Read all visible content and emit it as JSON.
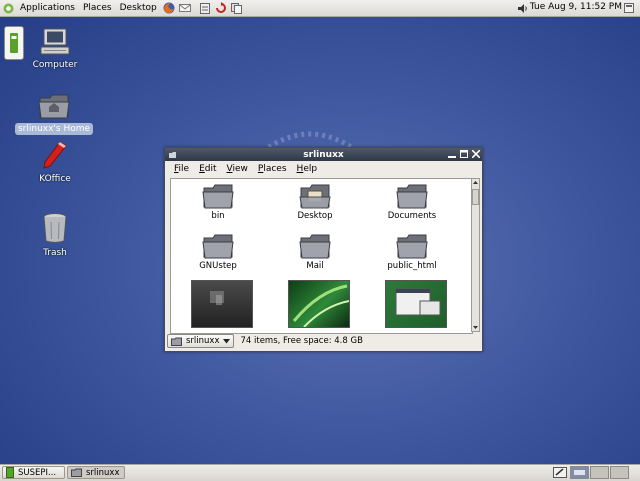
{
  "top_panel": {
    "menus": [
      "Applications",
      "Places",
      "Desktop"
    ],
    "clock": "Tue Aug  9, 11:52 PM",
    "icons": [
      "suse-logo-icon",
      "firefox-icon",
      "mail-icon",
      "notes-icon",
      "update-icon",
      "copy-icon",
      "volume-icon"
    ]
  },
  "desktop": {
    "icons": [
      {
        "label": "Computer",
        "icon": "computer-icon"
      },
      {
        "label": "srlinuxx's Home",
        "icon": "home-folder-icon",
        "selected": true
      },
      {
        "label": "KOffice",
        "icon": "koffice-icon"
      },
      {
        "label": "Trash",
        "icon": "trash-icon"
      }
    ]
  },
  "window": {
    "title": "srlinuxx",
    "menu": [
      "File",
      "Edit",
      "View",
      "Places",
      "Help"
    ],
    "files": [
      {
        "label": "bin"
      },
      {
        "label": "Desktop"
      },
      {
        "label": "Documents"
      },
      {
        "label": "GNUstep"
      },
      {
        "label": "Mail"
      },
      {
        "label": "public_html"
      }
    ],
    "thumbnails": [
      "image-thumbnail-1",
      "image-thumbnail-2",
      "image-thumbnail-3"
    ],
    "location": "srlinuxx",
    "status": "74 items, Free space: 4.8 GB"
  },
  "taskbar": {
    "tasks": [
      "SUSEPI...",
      "srlinuxx"
    ]
  },
  "colors": {
    "desktop_bg": "#3f58a0",
    "titlebar": "#3a4352",
    "panel": "#e6e4df"
  }
}
